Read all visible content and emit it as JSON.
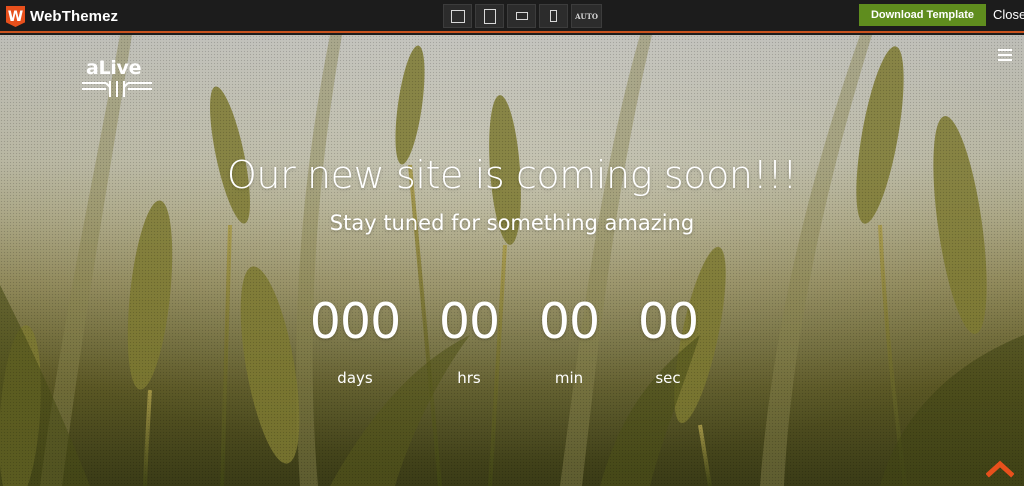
{
  "topbar": {
    "brand_badge": "W",
    "brand_name": "WebThemez",
    "device_buttons": [
      "desktop-view",
      "tablet-landscape-view",
      "tablet-view",
      "mobile-view",
      "auto-view"
    ],
    "auto_label": "AUTO",
    "download_label": "Download Template",
    "close_label": "Close"
  },
  "site": {
    "logo_text": "aLive",
    "headline": "Our new site is coming soon!!!",
    "subline": "Stay tuned for something amazing",
    "countdown": [
      {
        "value": "000",
        "label": "days"
      },
      {
        "value": "00",
        "label": "hrs"
      },
      {
        "value": "00",
        "label": "min"
      },
      {
        "value": "00",
        "label": "sec"
      }
    ]
  },
  "colors": {
    "topbar_bg": "#1c1c1c",
    "topbar_border": "#c8531f",
    "brand_badge": "#e8501c",
    "download_button": "#5f8d1e",
    "scroll_top_arrow": "#e8501c",
    "text": "#ffffff"
  },
  "icons": {
    "menu": "hamburger-menu-icon",
    "scroll_top": "chevron-up-icon",
    "brand": "webthemez-shield-icon"
  }
}
